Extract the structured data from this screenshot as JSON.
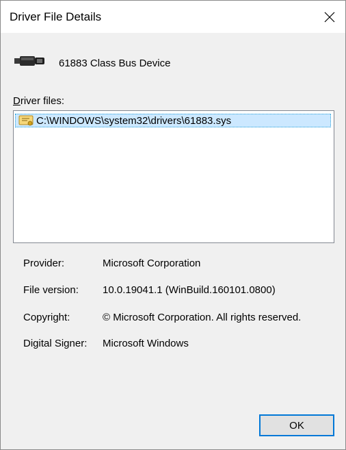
{
  "window": {
    "title": "Driver File Details"
  },
  "device": {
    "name": "61883 Class Bus Device",
    "icon": "device-connector-icon"
  },
  "driver_files": {
    "label_underlined": "D",
    "label_rest": "river files:",
    "items": [
      {
        "path": "C:\\WINDOWS\\system32\\drivers\\61883.sys",
        "icon": "certificate-icon",
        "selected": true
      }
    ]
  },
  "properties": [
    {
      "label": "Provider:",
      "value": "Microsoft Corporation"
    },
    {
      "label": "File version:",
      "value": "10.0.19041.1 (WinBuild.160101.0800)"
    },
    {
      "label": "Copyright:",
      "value": "© Microsoft Corporation. All rights reserved."
    },
    {
      "label": "Digital Signer:",
      "value": "Microsoft Windows"
    }
  ],
  "buttons": {
    "ok_label": "OK"
  },
  "colors": {
    "dialog_bg": "#f0f0f0",
    "selection_bg": "#cce8ff",
    "focus_border": "#0078d7"
  }
}
